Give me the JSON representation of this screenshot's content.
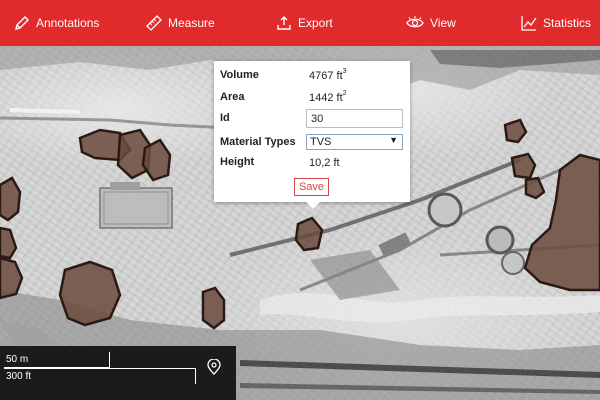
{
  "toolbar": {
    "items": [
      {
        "label": "Annotations",
        "icon": "pencil-icon"
      },
      {
        "label": "Measure",
        "icon": "ruler-icon"
      },
      {
        "label": "Export",
        "icon": "export-icon"
      },
      {
        "label": "View",
        "icon": "eye-icon"
      },
      {
        "label": "Statistics",
        "icon": "line-chart-icon"
      }
    ],
    "background": "#e02a2b"
  },
  "popup": {
    "volume_label": "Volume",
    "volume_value": "4767 ft",
    "volume_unit_exp": "3",
    "area_label": "Area",
    "area_value": "1442 ft",
    "area_unit_exp": "2",
    "id_label": "Id",
    "id_value": "30",
    "material_label": "Material Types",
    "material_value": "TVS",
    "height_label": "Height",
    "height_value": "10,2 ft",
    "save_label": "Save",
    "save_color": "#d84646"
  },
  "scale": {
    "metric": "50 m",
    "imperial": "300 ft"
  },
  "stockpile_color": "#6b4a3d"
}
